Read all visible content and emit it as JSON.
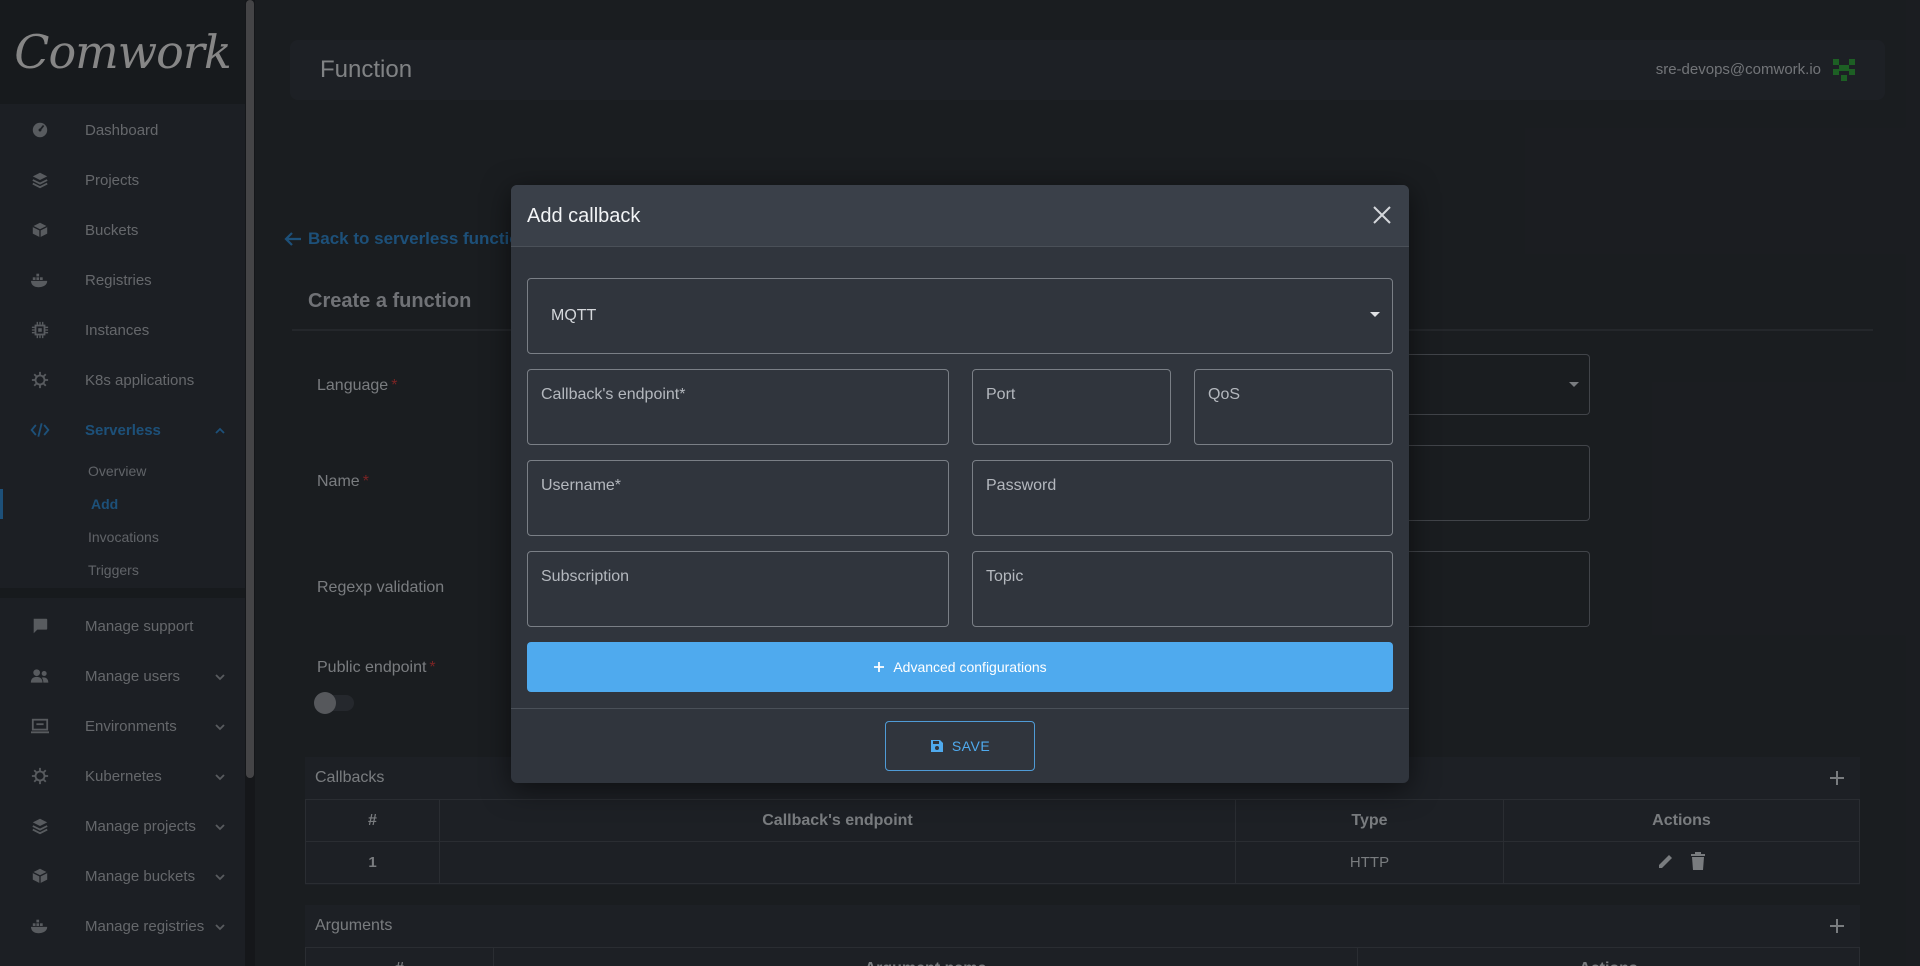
{
  "sidebar": {
    "logo_text": "Comwork",
    "items": [
      {
        "label": "Dashboard",
        "icon": "dashboard-icon"
      },
      {
        "label": "Projects",
        "icon": "layers-icon"
      },
      {
        "label": "Buckets",
        "icon": "box-icon"
      },
      {
        "label": "Registries",
        "icon": "docker-icon"
      },
      {
        "label": "Instances",
        "icon": "chip-icon"
      },
      {
        "label": "K8s applications",
        "icon": "helm-icon"
      },
      {
        "label": "Serverless",
        "icon": "code-icon"
      }
    ],
    "serverless_sub": [
      "Overview",
      "Add",
      "Invocations",
      "Triggers"
    ],
    "admin_items": [
      {
        "label": "Manage support",
        "icon": "chat-icon"
      },
      {
        "label": "Manage users",
        "icon": "users-icon"
      },
      {
        "label": "Environments",
        "icon": "monitor-icon"
      },
      {
        "label": "Kubernetes",
        "icon": "helm-icon"
      },
      {
        "label": "Manage projects",
        "icon": "layers-icon"
      },
      {
        "label": "Manage buckets",
        "icon": "box-icon"
      },
      {
        "label": "Manage registries",
        "icon": "docker-icon"
      }
    ]
  },
  "header": {
    "title": "Function",
    "user_email": "sre-devops@comwork.io"
  },
  "page": {
    "back_link": "Back to serverless functio",
    "create_title": "Create a function",
    "language_label": "Language",
    "name_label": "Name",
    "regexp_label": "Regexp validation",
    "public_endpoint_label": "Public endpoint",
    "required_marker": "*"
  },
  "callbacks": {
    "title": "Callbacks",
    "columns": [
      "#",
      "Callback's endpoint",
      "Type",
      "Actions"
    ],
    "rows": [
      {
        "num": "1",
        "endpoint": "",
        "type": "HTTP"
      }
    ]
  },
  "arguments": {
    "title": "Arguments",
    "columns": [
      "#",
      "Argument name",
      "Actions"
    ]
  },
  "modal": {
    "title": "Add callback",
    "type_selected": "MQTT",
    "endpoint_placeholder": "Callback's endpoint*",
    "port_placeholder": "Port",
    "qos_placeholder": "QoS",
    "username_placeholder": "Username*",
    "password_placeholder": "Password",
    "subscription_placeholder": "Subscription",
    "topic_placeholder": "Topic",
    "advanced_label": "Advanced configurations",
    "save_label": "SAVE"
  },
  "colors": {
    "accent": "#2f82c4",
    "primary_button": "#4faaee",
    "required": "#c63a3a"
  }
}
